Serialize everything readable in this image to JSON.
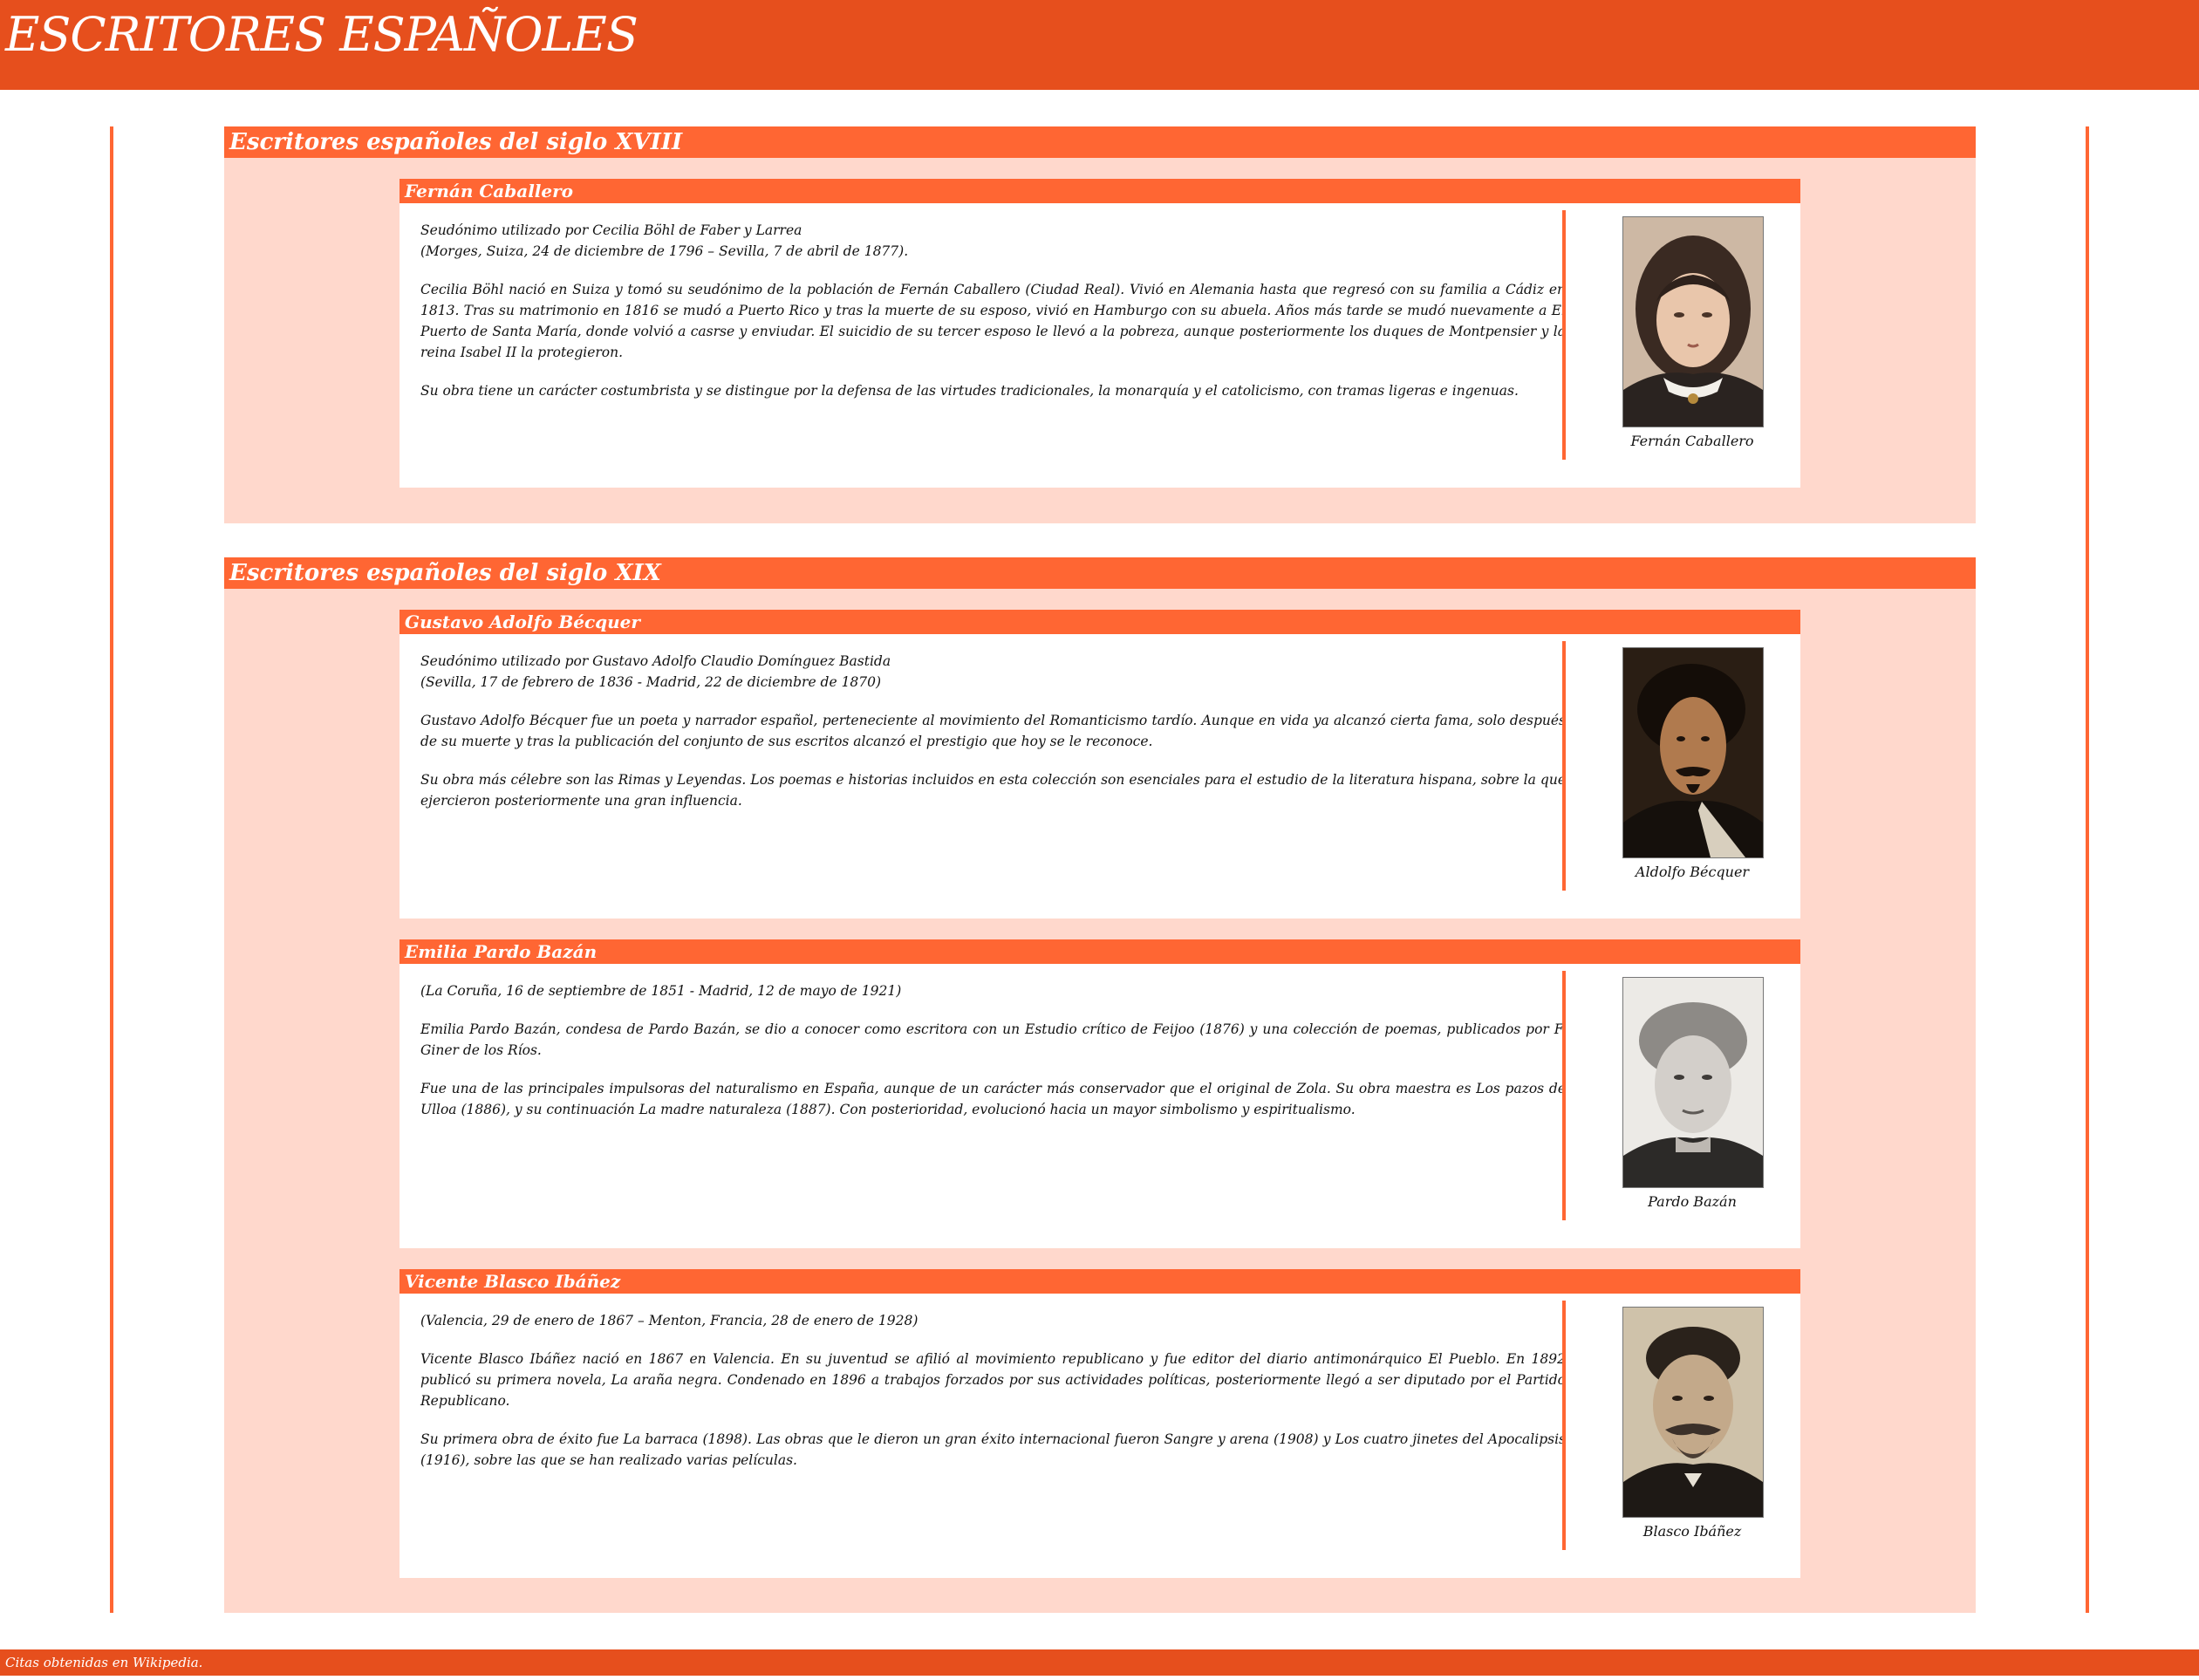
{
  "header": {
    "title": "ESCRITORES ESPAÑOLES"
  },
  "sections": [
    {
      "title": "Escritores españoles del siglo XVIII",
      "writers": [
        {
          "name": "Fernán Caballero",
          "bio_line1": "Seudónimo utilizado por Cecilia Böhl de Faber y Larrea",
          "bio_line2": "(Morges, Suiza, 24 de diciembre de 1796 – Sevilla, 7 de abril de 1877).",
          "p1": "Cecilia Böhl nació en Suiza y tomó su seudónimo de la población de Fernán Caballero (Ciudad Real). Vivió en Alemania hasta que regresó con su familia a Cádiz en 1813. Tras su matrimonio en 1816 se mudó a Puerto Rico y tras la muerte de su esposo, vivió en Hamburgo con su abuela. Años más tarde se mudó nuevamente a El Puerto de Santa María, donde volvió a casrse y enviudar. El suicidio de su tercer esposo le llevó a la pobreza, aunque posteriormente los duques de Montpensier y la reina Isabel II la protegieron.",
          "p2": "Su obra tiene un carácter costumbrista y se distingue por la defensa de las virtudes tradicionales, la monarquía y el catolicismo, con tramas ligeras e ingenuas.",
          "caption": "Fernán Caballero"
        }
      ]
    },
    {
      "title": "Escritores españoles del siglo XIX",
      "writers": [
        {
          "name": "Gustavo Adolfo Bécquer",
          "bio_line1": "Seudónimo utilizado por Gustavo Adolfo Claudio Domínguez Bastida",
          "bio_line2": "(Sevilla, 17 de febrero de 1836 - Madrid, 22 de diciembre de 1870)",
          "p1": "Gustavo Adolfo Bécquer fue un poeta y narrador español, perteneciente al movimiento del Romanticismo tardío. Aunque en vida ya alcanzó cierta fama, solo después de su muerte y tras la publicación del conjunto de sus escritos alcanzó el prestigio que hoy se le reconoce.",
          "p2": "Su obra más célebre son las Rimas y Leyendas. Los poemas e historias incluidos en esta colección son esenciales para el estudio de la literatura hispana, sobre la que ejercieron posteriormente una gran influencia.",
          "caption": "Aldolfo Bécquer"
        },
        {
          "name": "Emilia Pardo Bazán",
          "bio_line1": "(La Coruña, 16 de septiembre de 1851 - Madrid, 12 de mayo de 1921)",
          "p1": "Emilia Pardo Bazán, condesa de Pardo Bazán, se dio a conocer como escritora con un Estudio crítico de Feijoo (1876) y una colección de poemas, publicados por F. Giner de los Ríos.",
          "p2": "Fue una de las principales impulsoras del naturalismo en España, aunque de un carácter más conservador que el original de Zola. Su obra maestra es Los pazos de Ulloa (1886), y su continuación La madre naturaleza (1887). Con posterioridad, evolucionó hacia un mayor simbolismo y espiritualismo.",
          "caption": "Pardo Bazán"
        },
        {
          "name": "Vicente Blasco Ibáñez",
          "bio_line1": "(Valencia, 29 de enero de 1867 – Menton, Francia, 28 de enero de 1928)",
          "p1": "Vicente Blasco Ibáñez nació en 1867 en Valencia. En su juventud se afilió al movimiento republicano y fue editor del diario antimonárquico El Pueblo. En 1892 publicó su primera novela, La araña negra. Condenado en 1896 a trabajos forzados por sus actividades políticas, posteriormente llegó a ser diputado por el Partido Republicano.",
          "p2": "Su primera obra de éxito fue La barraca (1898). Las obras que le dieron un gran éxito internacional fueron Sangre y arena (1908) y Los cuatro jinetes del Apocalipsis (1916), sobre las que se han realizado varias películas.",
          "caption": "Blasco Ibáñez"
        }
      ]
    }
  ],
  "footer": {
    "text": "Citas obtenidas en Wikipedia."
  },
  "colors": {
    "header": "#e64f1d",
    "accent": "#ff6633",
    "section_bg": "#ffd8cc"
  }
}
